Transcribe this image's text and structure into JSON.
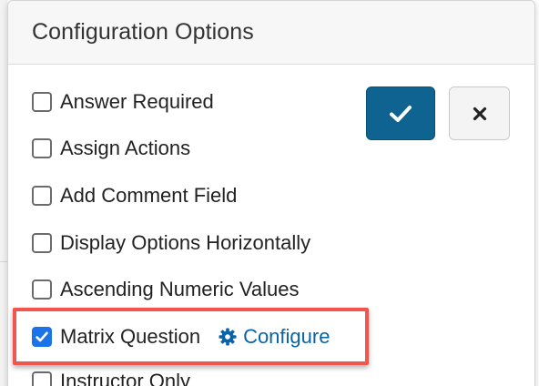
{
  "popover": {
    "title": "Configuration Options"
  },
  "options": [
    {
      "label": "Answer Required",
      "checked": false
    },
    {
      "label": "Assign Actions",
      "checked": false
    },
    {
      "label": "Add Comment Field",
      "checked": false
    },
    {
      "label": "Display Options Horizontally",
      "checked": false
    },
    {
      "label": "Ascending Numeric Values",
      "checked": false
    },
    {
      "label": "Matrix Question",
      "checked": true
    },
    {
      "label": "Instructor Only",
      "checked": false
    }
  ],
  "configure_link": {
    "label": "Configure",
    "icon": "gear-icon"
  },
  "buttons": {
    "confirm_icon": "checkmark-icon",
    "cancel_icon": "close-icon"
  },
  "colors": {
    "confirm_bg": "#0e6391",
    "checked_bg": "#1a73e8",
    "link": "#0b63a7",
    "highlight": "#f1554c"
  }
}
